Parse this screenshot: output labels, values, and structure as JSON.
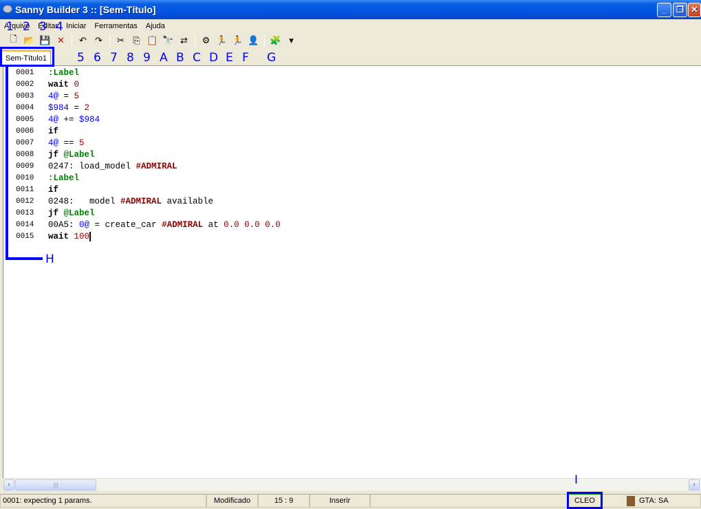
{
  "window": {
    "title": "Sanny Builder 3 :: [Sem-Título]"
  },
  "menu": [
    "Arquivo",
    "Editar",
    "Iniciar",
    "Ferramentas",
    "Ajuda"
  ],
  "toolbar": [
    {
      "icon": "new-file-icon",
      "glyph": "🗋"
    },
    {
      "icon": "open-folder-icon",
      "glyph": "📂"
    },
    {
      "icon": "save-icon",
      "glyph": "💾"
    },
    {
      "icon": "close-icon",
      "glyph": "✕"
    },
    {
      "sep": true
    },
    {
      "icon": "undo-icon",
      "glyph": "↶"
    },
    {
      "icon": "redo-icon",
      "glyph": "↷"
    },
    {
      "sep": true
    },
    {
      "icon": "cut-icon",
      "glyph": "✂"
    },
    {
      "icon": "copy-icon",
      "glyph": "⎘"
    },
    {
      "icon": "paste-icon",
      "glyph": "📋"
    },
    {
      "icon": "find-icon",
      "glyph": "🔭"
    },
    {
      "icon": "replace-icon",
      "glyph": "⇄"
    },
    {
      "sep": true
    },
    {
      "icon": "compile-icon",
      "glyph": "⚙"
    },
    {
      "icon": "run-icon",
      "glyph": "🏃"
    },
    {
      "icon": "compile-run-icon",
      "glyph": "🏃"
    },
    {
      "icon": "game-icon",
      "glyph": "👤"
    },
    {
      "sep": true
    },
    {
      "icon": "plugins-icon",
      "glyph": "🧩"
    },
    {
      "icon": "dropdown-arrow-icon",
      "glyph": "▾"
    }
  ],
  "tab": {
    "label": "Sem-Título1"
  },
  "code": [
    [
      [
        "lbl",
        ":Label"
      ]
    ],
    [
      [
        "kw",
        "wait"
      ],
      [
        "txt",
        " "
      ],
      [
        "num",
        "0"
      ]
    ],
    [
      [
        "var",
        "4@"
      ],
      [
        "txt",
        " = "
      ],
      [
        "num",
        "5"
      ]
    ],
    [
      [
        "var",
        "$984"
      ],
      [
        "txt",
        " = "
      ],
      [
        "num",
        "2"
      ]
    ],
    [
      [
        "var",
        "4@"
      ],
      [
        "txt",
        " += "
      ],
      [
        "var",
        "$984"
      ]
    ],
    [
      [
        "kw",
        "if"
      ]
    ],
    [
      [
        "var",
        "4@"
      ],
      [
        "txt",
        " == "
      ],
      [
        "num",
        "5"
      ]
    ],
    [
      [
        "kw",
        "jf"
      ],
      [
        "txt",
        " "
      ],
      [
        "lbl",
        "@Label"
      ]
    ],
    [
      [
        "txt",
        "0247: load_model "
      ],
      [
        "mdl",
        "#ADMIRAL"
      ]
    ],
    [
      [
        "lbl",
        ":Label"
      ]
    ],
    [
      [
        "kw",
        "if"
      ]
    ],
    [
      [
        "txt",
        "0248:   model "
      ],
      [
        "mdl",
        "#ADMIRAL"
      ],
      [
        "txt",
        " available"
      ]
    ],
    [
      [
        "kw",
        "jf"
      ],
      [
        "txt",
        " "
      ],
      [
        "lbl",
        "@Label"
      ]
    ],
    [
      [
        "txt",
        "00A5: "
      ],
      [
        "var",
        "0@"
      ],
      [
        "txt",
        " = create_car "
      ],
      [
        "mdl",
        "#ADMIRAL"
      ],
      [
        "txt",
        " at "
      ],
      [
        "num",
        "0.0 0.0 0.0"
      ]
    ],
    [
      [
        "kw",
        "wait"
      ],
      [
        "txt",
        " "
      ],
      [
        "num",
        "100"
      ]
    ]
  ],
  "line_numbers": [
    "0001",
    "0002",
    "0003",
    "0004",
    "0005",
    "0006",
    "0007",
    "0008",
    "0009",
    "0010",
    "0011",
    "0012",
    "0013",
    "0014",
    "0015"
  ],
  "cursor": {
    "line": 15,
    "col": 9
  },
  "status": {
    "message": "0001: expecting 1 params.",
    "modified": "Modificado",
    "position": "15 :  9",
    "mode": "Inserir",
    "cleo": "CLEO",
    "game": "GTA: SA"
  },
  "annotations": {
    "top": [
      "1",
      "2",
      "3",
      "4"
    ],
    "toolbar": [
      "5",
      "6",
      "7",
      "8",
      "9",
      "A",
      "B",
      "C",
      "D",
      "E",
      "F",
      "G"
    ],
    "h": "H",
    "i": "I"
  },
  "colors": {
    "keyword": "#000000",
    "label": "#008000",
    "variable": "#0000ff",
    "number": "#8b0000",
    "model": "#8b0000",
    "annotation": "#0000ff"
  }
}
